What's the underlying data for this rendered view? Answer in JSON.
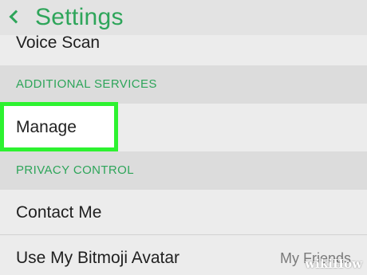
{
  "header": {
    "back_icon": "chevron-left-icon",
    "title": "Settings"
  },
  "rows": {
    "voice_scan": "Voice Scan",
    "manage": "Manage",
    "contact_me": "Contact Me",
    "bitmoji_avatar": "Use My Bitmoji Avatar",
    "bitmoji_avatar_value": "My Friends"
  },
  "sections": {
    "additional_services": "ADDITIONAL SERVICES",
    "privacy_control": "PRIVACY CONTROL"
  },
  "watermark": "wikiHow",
  "colors": {
    "accent": "#2ea55a",
    "highlight_border": "#2df230",
    "background": "#ececec",
    "section_background": "#dcdcdc"
  }
}
